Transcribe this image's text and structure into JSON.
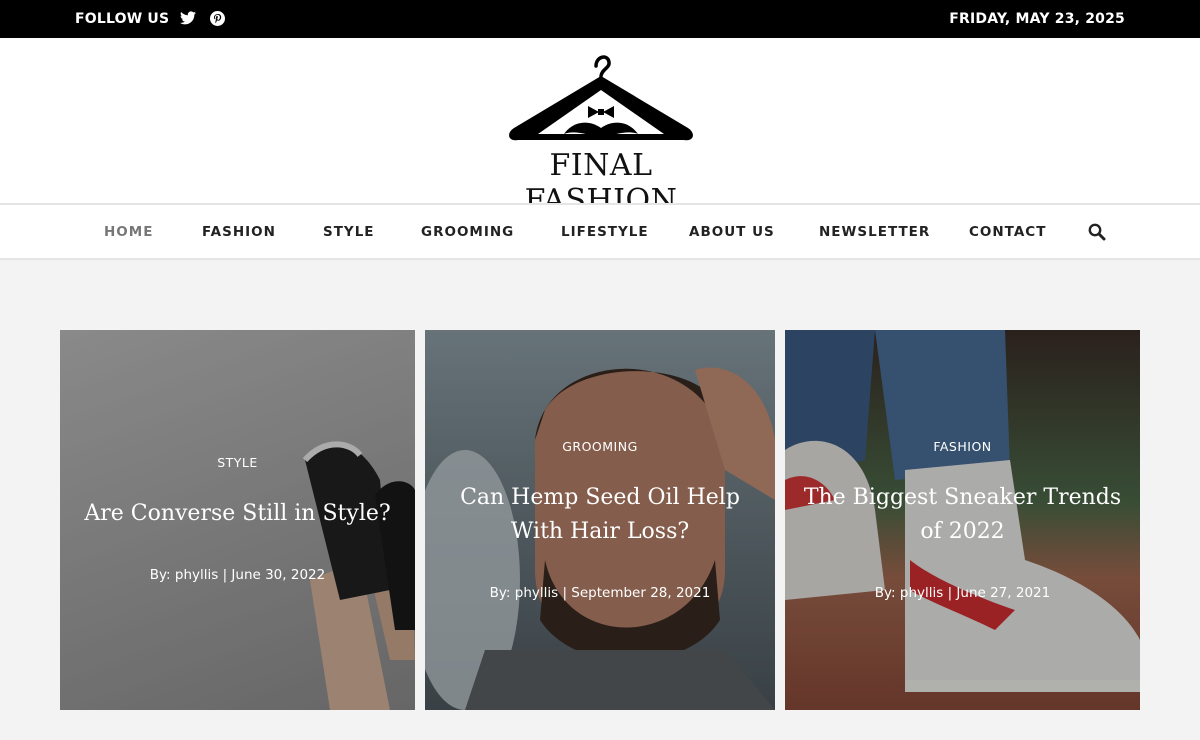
{
  "topbar": {
    "follow_label": "FOLLOW US",
    "date": "FRIDAY, MAY 23, 2025"
  },
  "brand": {
    "name": "FINAL FASHION"
  },
  "nav": {
    "items": [
      "HOME",
      "FASHION",
      "STYLE",
      "GROOMING",
      "LIFESTYLE",
      "ABOUT US",
      "NEWSLETTER",
      "CONTACT"
    ],
    "active": "HOME"
  },
  "posts": [
    {
      "category": "STYLE",
      "title": "Are Converse Still in Style?",
      "meta": "By: phyllis | June 30, 2022"
    },
    {
      "category": "GROOMING",
      "title": "Can Hemp Seed Oil Help With Hair Loss?",
      "meta": "By: phyllis | September 28, 2021"
    },
    {
      "category": "FASHION",
      "title": "The Biggest Sneaker Trends of 2022",
      "meta": "By: phyllis | June 27, 2021"
    }
  ],
  "colors": {
    "topbar": "#000000",
    "background": "#f3f3f3",
    "active_nav": "#777777"
  },
  "icons": [
    "twitter-icon",
    "pinterest-icon",
    "search-icon",
    "hanger-logo"
  ]
}
